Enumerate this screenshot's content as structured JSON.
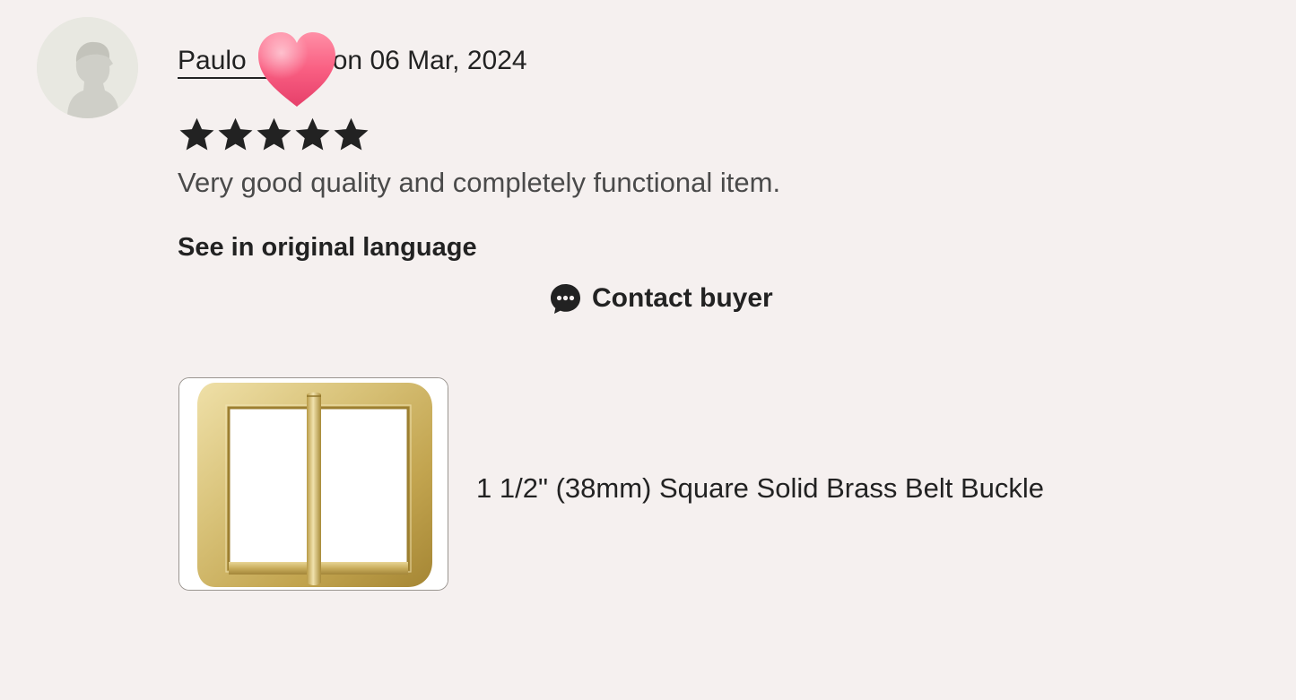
{
  "review": {
    "reviewer_name": "Paulo",
    "date_text": "on 06 Mar, 2024",
    "rating": 5,
    "rating_max": 5,
    "text": "Very good quality and completely functional item.",
    "see_original_label": "See in original language",
    "contact_buyer_label": "Contact buyer"
  },
  "product": {
    "title": "1 1/2\" (38mm) Square Solid Brass Belt Buckle"
  },
  "icons": {
    "avatar": "default-avatar-silhouette",
    "overlay": "heart-icon",
    "star": "star-icon",
    "contact": "chat-bubble-icon"
  },
  "colors": {
    "background": "#f5f0ef",
    "text": "#222222",
    "review_text": "#4a4a4a",
    "heart": "#f5577d"
  }
}
